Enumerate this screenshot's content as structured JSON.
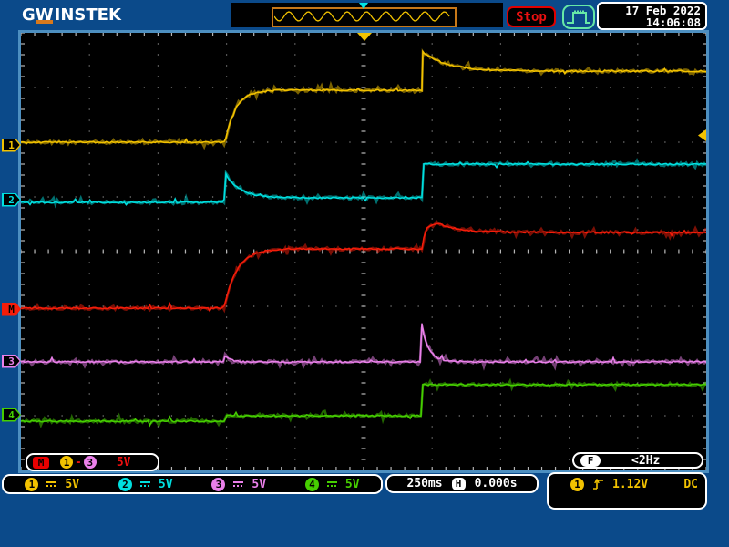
{
  "header": {
    "logo": {
      "g": "G",
      "w": "W",
      "rest": "INSTEK"
    },
    "stop_label": "Stop",
    "date": "17 Feb 2022",
    "time": "14:06:08"
  },
  "footer": {
    "math": {
      "badge": "M",
      "ch_a": "1",
      "op": "-",
      "ch_b": "3",
      "scale": "5V"
    },
    "freq": {
      "badge": "F",
      "value": "<2Hz"
    },
    "channels": [
      {
        "num": "1",
        "scale": "5V",
        "color": "#f2c200"
      },
      {
        "num": "2",
        "scale": "5V",
        "color": "#00dfdf"
      },
      {
        "num": "3",
        "scale": "5V",
        "color": "#ea80ea"
      },
      {
        "num": "4",
        "scale": "5V",
        "color": "#46cf00"
      }
    ],
    "timebase": {
      "scale": "250ms",
      "h_badge": "H",
      "position": "0.000s"
    },
    "trigger": {
      "source": "1",
      "level": "1.12V",
      "coupling": "DC"
    }
  },
  "plot": {
    "markers": [
      {
        "label": "1",
        "color": "#f2c200",
        "y": 159,
        "filled": false
      },
      {
        "label": "2",
        "color": "#00dfdf",
        "y": 219,
        "filled": false
      },
      {
        "label": "M",
        "color": "#f51d0a",
        "y": 339,
        "filled": true
      },
      {
        "label": "3",
        "color": "#ea80ea",
        "y": 396,
        "filled": false
      },
      {
        "label": "4",
        "color": "#46cf00",
        "y": 455,
        "filled": false
      }
    ],
    "trigger": {
      "color": "#f2c200",
      "position_x": 400,
      "level_y": 148
    }
  },
  "chart_data": {
    "type": "line",
    "title": "",
    "x_axis": {
      "divisions": 10,
      "per_division": "250ms",
      "grid": "dotted"
    },
    "y_axis": {
      "divisions": 8,
      "per_division": "5V (all channels and math)"
    },
    "trigger": {
      "source": "CH1",
      "level": "1.12V",
      "coupling": "DC",
      "frequency": "<2Hz",
      "position": "0.000s",
      "state": "Stop"
    },
    "note": "points are [x_px,y_px,interp] in 752x480 plot pixels; interp of segment from previous point: line|exp",
    "series": [
      {
        "name": "CH1",
        "color": "#f2c200",
        "seed": 11,
        "points": [
          [
            0,
            120
          ],
          [
            223,
            120,
            "line"
          ],
          [
            225,
            116,
            "line"
          ],
          [
            280,
            63,
            "exp"
          ],
          [
            440,
            63,
            "line"
          ],
          [
            441,
            21,
            "line"
          ],
          [
            575,
            42,
            "exp"
          ],
          [
            752,
            42,
            "line"
          ]
        ]
      },
      {
        "name": "CH2",
        "color": "#00dfdf",
        "seed": 22,
        "points": [
          [
            0,
            186
          ],
          [
            223,
            186,
            "line"
          ],
          [
            225,
            155,
            "line"
          ],
          [
            302,
            181,
            "exp"
          ],
          [
            440,
            181,
            "line"
          ],
          [
            442,
            144,
            "line"
          ],
          [
            752,
            144,
            "line"
          ]
        ]
      },
      {
        "name": "MATH (1-3)",
        "color": "#f51d0a",
        "seed": 33,
        "points": [
          [
            0,
            302
          ],
          [
            223,
            302,
            "line"
          ],
          [
            292,
            237,
            "exp"
          ],
          [
            440,
            237,
            "line"
          ],
          [
            458,
            209,
            "exp"
          ],
          [
            575,
            219,
            "exp"
          ],
          [
            752,
            219,
            "line"
          ]
        ]
      },
      {
        "name": "CH3",
        "color": "#ea80ea",
        "seed": 44,
        "points": [
          [
            0,
            361
          ],
          [
            222,
            361,
            "line"
          ],
          [
            224,
            354,
            "line"
          ],
          [
            254,
            361,
            "exp"
          ],
          [
            438,
            361,
            "line"
          ],
          [
            440,
            322,
            "line"
          ],
          [
            480,
            361,
            "exp"
          ],
          [
            752,
            361,
            "line"
          ]
        ]
      },
      {
        "name": "CH4",
        "color": "#46cf00",
        "seed": 55,
        "points": [
          [
            0,
            426
          ],
          [
            223,
            426,
            "line"
          ],
          [
            226,
            420,
            "line"
          ],
          [
            439,
            420,
            "line"
          ],
          [
            441,
            386,
            "line"
          ],
          [
            752,
            386,
            "line"
          ]
        ]
      }
    ]
  }
}
